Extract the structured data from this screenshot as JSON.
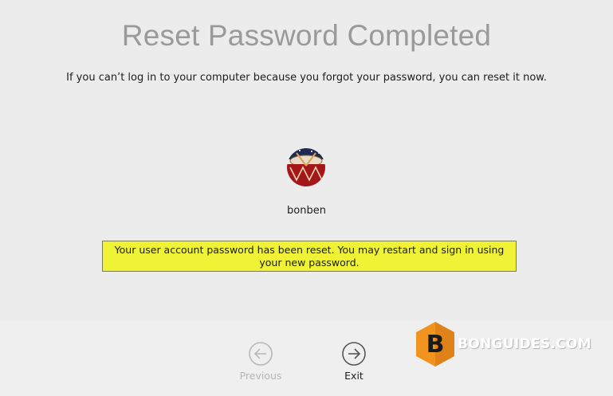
{
  "header": {
    "title": "Reset Password Completed",
    "subtitle": "If you can’t log in to your computer because you forgot your password, you can reset it now."
  },
  "user": {
    "avatar_icon": "user-avatar-drum-icon",
    "name": "bonben"
  },
  "notice": {
    "text": "Your user account password has been reset. You may restart and sign in using your new password."
  },
  "footer": {
    "previous_label": "Previous",
    "previous_icon": "arrow-left-circle-icon",
    "exit_label": "Exit",
    "exit_icon": "arrow-right-circle-icon"
  },
  "watermark": {
    "logo_letter": "B",
    "text": "BONGUIDES.COM"
  },
  "colors": {
    "background": "#ececec",
    "notice_background": "#eff235",
    "watermark_orange": "#f0931f"
  }
}
